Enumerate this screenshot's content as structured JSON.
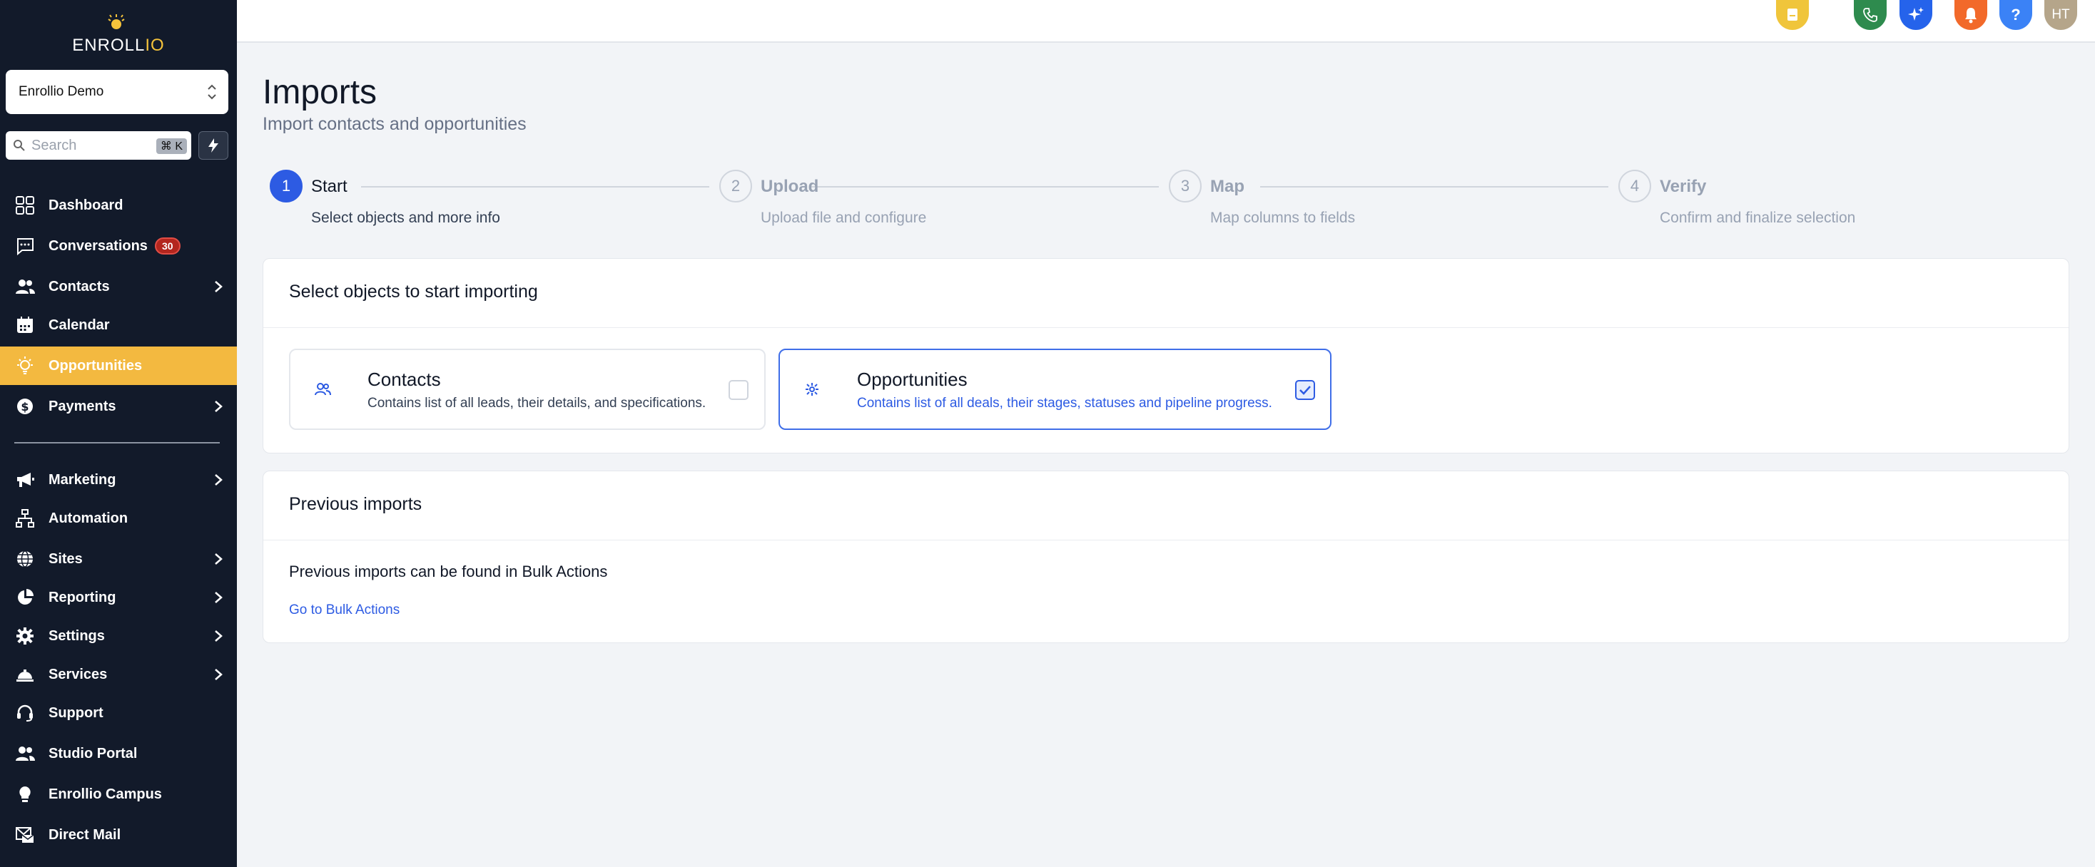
{
  "brand": {
    "part1": "ENROLL",
    "part2": "IO",
    "accent": "#f5c33b"
  },
  "account": {
    "name": "Enrollio Demo"
  },
  "search": {
    "placeholder": "Search",
    "shortcut": "⌘ K"
  },
  "sidebar": {
    "items": [
      {
        "label": "Dashboard",
        "icon": "dashboard-icon"
      },
      {
        "label": "Conversations",
        "icon": "chat-icon",
        "badge": "30"
      },
      {
        "label": "Contacts",
        "icon": "users-icon"
      },
      {
        "label": "Calendar",
        "icon": "calendar-icon"
      },
      {
        "label": "Opportunities",
        "icon": "lightbulb-icon",
        "active": true
      },
      {
        "label": "Payments",
        "icon": "dollar-icon"
      },
      {
        "label": "Marketing",
        "icon": "megaphone-icon"
      },
      {
        "label": "Automation",
        "icon": "workflow-icon"
      },
      {
        "label": "Sites",
        "icon": "globe-icon"
      },
      {
        "label": "Reporting",
        "icon": "pie-chart-icon"
      },
      {
        "label": "Settings",
        "icon": "gear-icon"
      },
      {
        "label": "Services",
        "icon": "service-bell-icon"
      },
      {
        "label": "Support",
        "icon": "headset-icon"
      },
      {
        "label": "Studio Portal",
        "icon": "users-icon"
      },
      {
        "label": "Enrollio Campus",
        "icon": "bulb-icon"
      },
      {
        "label": "Direct Mail",
        "icon": "mail-icon"
      }
    ]
  },
  "topbar": {
    "avatar_initials": "HT",
    "help_label": "?"
  },
  "colors": {
    "active_nav": "#f3b940",
    "primary": "#2d5be3"
  },
  "page": {
    "title": "Imports",
    "subtitle": "Import contacts and opportunities"
  },
  "steps": [
    {
      "num": "1",
      "label": "Start",
      "desc": "Select objects and more info"
    },
    {
      "num": "2",
      "label": "Upload",
      "desc": "Upload file and configure"
    },
    {
      "num": "3",
      "label": "Map",
      "desc": "Map columns to fields"
    },
    {
      "num": "4",
      "label": "Verify",
      "desc": "Confirm and finalize selection"
    }
  ],
  "select_card": {
    "title": "Select objects to start importing",
    "objects": [
      {
        "title": "Contacts",
        "desc": "Contains list of all leads, their details, and specifications.",
        "checked": false
      },
      {
        "title": "Opportunities",
        "desc": "Contains list of all deals, their stages, statuses and pipeline progress.",
        "checked": true
      }
    ]
  },
  "previous_card": {
    "title": "Previous imports",
    "text": "Previous imports can be found in Bulk Actions",
    "link": "Go to Bulk Actions"
  }
}
